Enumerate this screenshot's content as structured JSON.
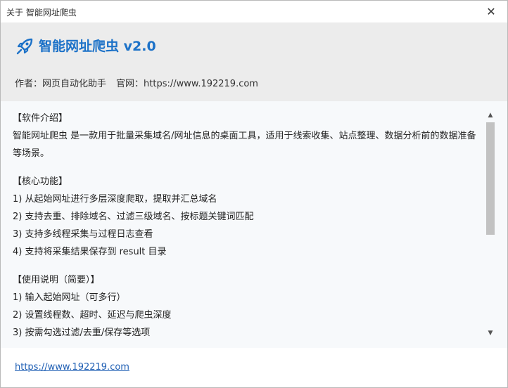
{
  "window": {
    "title": "关于 智能网址爬虫",
    "close_glyph": "✕"
  },
  "header": {
    "app_title": "智能网址爬虫 v2.0",
    "author_label": "作者：网页自动化助手",
    "site_label": "官网：https://www.192219.com",
    "accent_color": "#1d72c8"
  },
  "intro": {
    "heading": "【软件介绍】",
    "body": "智能网址爬虫 是一款用于批量采集域名/网址信息的桌面工具，适用于线索收集、站点整理、数据分析前的数据准备等场景。"
  },
  "features": {
    "heading": "【核心功能】",
    "items": [
      "1) 从起始网址进行多层深度爬取，提取并汇总域名",
      "2) 支持去重、排除域名、过滤三级域名、按标题关键词匹配",
      "3) 支持多线程采集与过程日志查看",
      "4) 支持将采集结果保存到 result 目录"
    ]
  },
  "usage": {
    "heading": "【使用说明（简要）】",
    "items": [
      "1) 输入起始网址（可多行）",
      "2) 设置线程数、超时、延迟与爬虫深度",
      "3) 按需勾选过滤/去重/保存等选项"
    ]
  },
  "scrollbar": {
    "up_glyph": "▲",
    "down_glyph": "▼"
  },
  "footer": {
    "link_text": "https://www.192219.com"
  }
}
